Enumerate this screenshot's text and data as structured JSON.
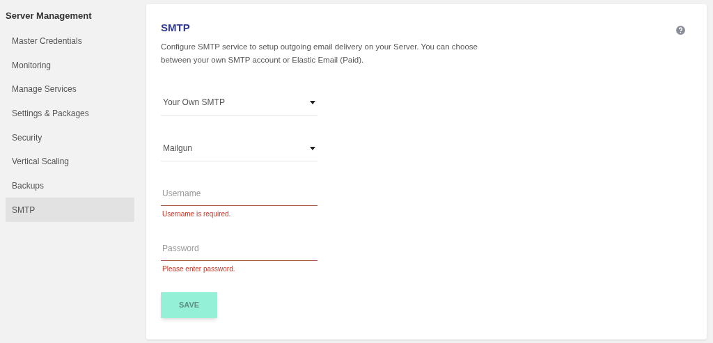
{
  "sidebar": {
    "title": "Server Management",
    "items": [
      {
        "label": "Master Credentials",
        "selected": false
      },
      {
        "label": "Monitoring",
        "selected": false
      },
      {
        "label": "Manage Services",
        "selected": false
      },
      {
        "label": "Settings & Packages",
        "selected": false
      },
      {
        "label": "Security",
        "selected": false
      },
      {
        "label": "Vertical Scaling",
        "selected": false
      },
      {
        "label": "Backups",
        "selected": false
      },
      {
        "label": "SMTP",
        "selected": true
      }
    ]
  },
  "panel": {
    "title": "SMTP",
    "description": "Configure SMTP service to setup outgoing email delivery on your Server. You can choose between your own SMTP account or Elastic Email (Paid).",
    "fields": [
      {
        "kind": "select",
        "value": "Your Own SMTP"
      },
      {
        "kind": "select",
        "value": "Mailgun"
      },
      {
        "kind": "input",
        "placeholder": "Username",
        "error": "Username is required."
      },
      {
        "kind": "input",
        "placeholder": "Password",
        "error": "Please enter password."
      }
    ],
    "save_button": {
      "label": "SAVE",
      "disabled": true
    }
  }
}
